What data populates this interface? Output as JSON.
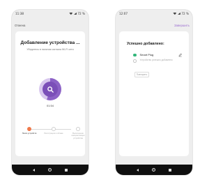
{
  "left_screen": {
    "status_time": "11:38",
    "status_battery": "72 %",
    "cancel_label": "Отмена",
    "title": "Добавление устройства ...",
    "subtitle": "Убедитесь в наличии сигнала Wi-Fi сети",
    "progress_fraction": 0.55,
    "timer": "01:54",
    "steps": [
      {
        "label": "Поиск устройств"
      },
      {
        "label": "Регистрация в облаке"
      },
      {
        "label": "Выполнение инициализации устройства"
      }
    ]
  },
  "right_screen": {
    "status_time": "12:07",
    "status_battery": "72 %",
    "finish_label": "Завершить",
    "title": "Успешно добавлено:",
    "devices": [
      {
        "name": "Smart Plug"
      },
      {
        "status": "Устройство успешно добавлено"
      }
    ],
    "retry_label": "Повторить"
  },
  "colors": {
    "accent": "#7b4fb8",
    "step_active": "#f0794a",
    "success": "#32b67a",
    "link": "#9b6dd0"
  },
  "icons": [
    "search-icon",
    "pencil-icon",
    "wifi-icon",
    "battery-icon",
    "back-icon",
    "home-icon",
    "recents-icon"
  ]
}
